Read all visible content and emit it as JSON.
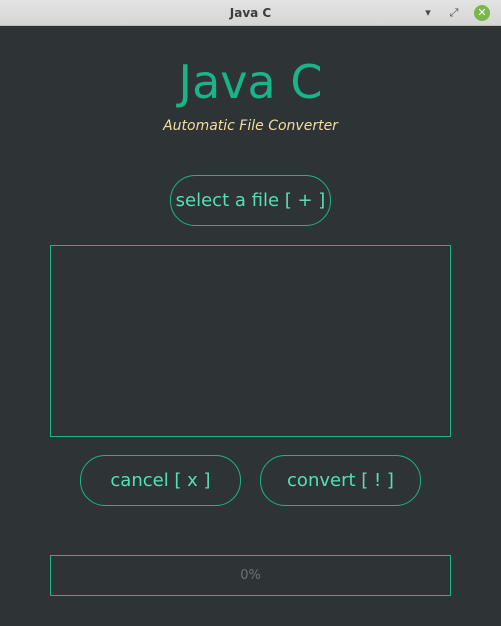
{
  "window": {
    "title": "Java C",
    "controls": {
      "minimize_icon": "▾",
      "maximize_icon": "⤢",
      "close_icon": "✕"
    }
  },
  "header": {
    "title": "Java C",
    "subtitle": "Automatic File Converter"
  },
  "actions": {
    "select_label": "select a file [ + ]",
    "cancel_label": "cancel [ x ]",
    "convert_label": "convert [ ! ]"
  },
  "progress": {
    "value": 0,
    "label": "0%"
  },
  "colors": {
    "background": "#2e3436",
    "accent": "#1ab38a",
    "button_text": "#55e0b3",
    "subtitle": "#f2dda0",
    "progress_text": "#6b7375"
  }
}
